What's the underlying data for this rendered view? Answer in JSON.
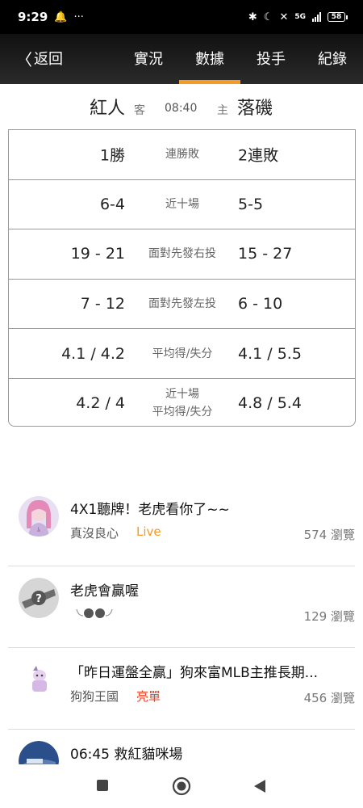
{
  "status_bar": {
    "time": "9:29",
    "dots": "···",
    "network": "5G",
    "battery": "58"
  },
  "nav": {
    "back_label": "返回",
    "tabs": [
      {
        "label": "實況"
      },
      {
        "label": "數據"
      },
      {
        "label": "投手"
      },
      {
        "label": "紀錄"
      }
    ],
    "active_tab": "數據",
    "accent_color": "#f59a23"
  },
  "matchup": {
    "away_team": "紅人",
    "away_tag": "客",
    "time": "08:40",
    "home_tag": "主",
    "home_team": "落磯"
  },
  "stats": [
    {
      "away": "1勝",
      "label": "連勝敗",
      "home": "2連敗"
    },
    {
      "away": "6-4",
      "label": "近十場",
      "home": "5-5"
    },
    {
      "away": "19 - 21",
      "label": "面對先發右投",
      "home": "15 - 27"
    },
    {
      "away": "7 - 12",
      "label": "面對先發左投",
      "home": "6 - 10"
    },
    {
      "away": "4.1 / 4.2",
      "label": "平均得/失分",
      "home": "4.1 / 5.5"
    },
    {
      "away": "4.2 / 4",
      "label_line1": "近十場",
      "label_line2": "平均得/失分",
      "home": "4.8 / 5.4"
    }
  ],
  "posts": [
    {
      "title": "4X1聽牌！老虎看你了~~",
      "author": "真沒良心",
      "badge": "Live",
      "badge_color": "#f59a23",
      "views": "574 瀏覽"
    },
    {
      "title": "老虎會贏喔",
      "author": "",
      "badge": "",
      "views": "129 瀏覽"
    },
    {
      "title": "「昨日運盤全贏」狗來富MLB主推長期...",
      "author": "狗狗王國",
      "badge": "亮單",
      "badge_color": "#e8432a",
      "views": "456 瀏覽"
    },
    {
      "title": "06:45 救紅貓咪場",
      "author": "",
      "badge": "",
      "views": ""
    }
  ]
}
